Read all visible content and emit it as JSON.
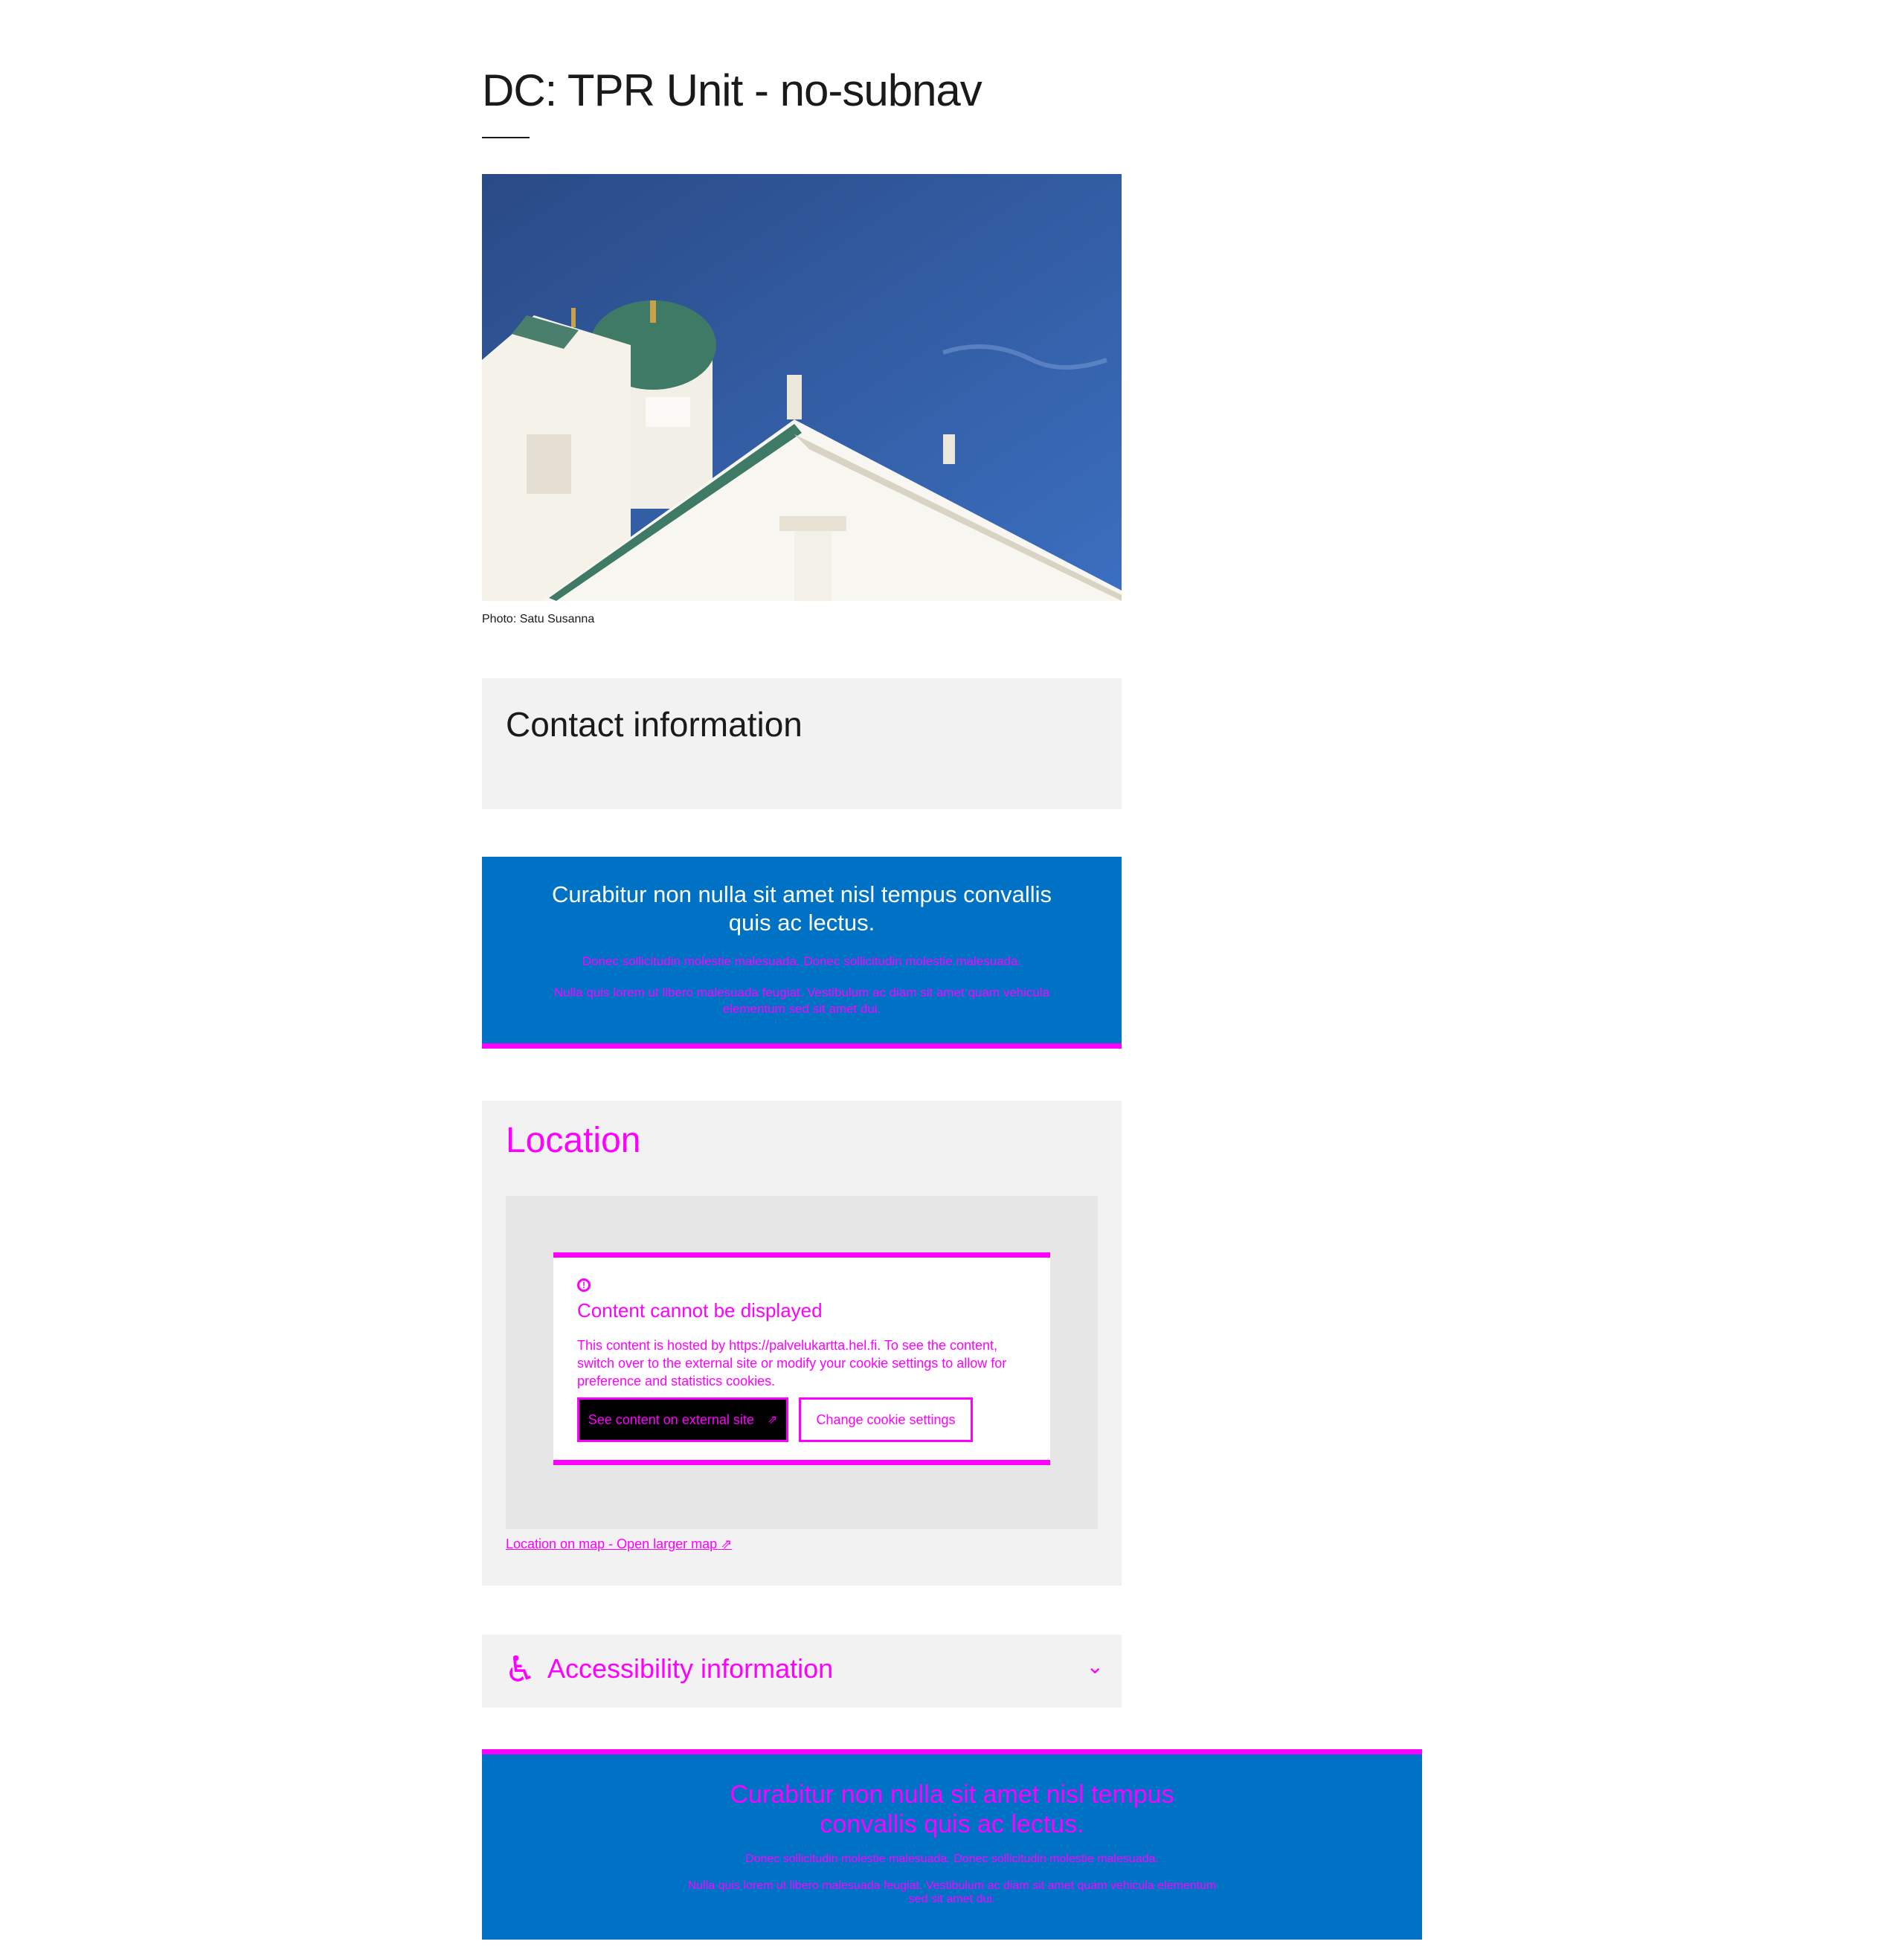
{
  "page": {
    "title": "DC: TPR Unit - no-subnav"
  },
  "hero": {
    "caption": "Photo: Satu Susanna"
  },
  "contact": {
    "heading": "Contact information"
  },
  "banner_top": {
    "title": "Curabitur non nulla sit amet nisl tempus convallis quis ac lectus.",
    "text1": "Donec sollicitudin molestie malesuada. Donec sollicitudin molestie malesuada.",
    "text2": "Nulla quis lorem ut libero malesuada feugiat. Vestibulum ac diam sit amet quam vehicula elementum sed sit amet dui."
  },
  "location": {
    "heading": "Location",
    "notice_title": "Content cannot be displayed",
    "notice_body": "This content is hosted by https://palvelukartta.hel.fi. To see the content, switch over to the external site or modify your cookie settings to allow for preference and statistics cookies.",
    "external_button": "See content on external site",
    "cookie_button": "Change cookie settings",
    "map_link": "Location on map - Open larger map"
  },
  "accessibility": {
    "label": "Accessibility information"
  },
  "banner_bottom": {
    "title": "Curabitur non nulla sit amet nisl tempus convallis quis ac lectus.",
    "text1": "Donec sollicitudin molestie malesuada. Donec sollicitudin molestie malesuada.",
    "text2": "Nulla quis lorem ut libero malesuada feugiat. Vestibulum ac diam sit amet quam vehicula elementum sed sit amet dui."
  },
  "colors": {
    "banner_blue": "#0072c6",
    "highlight_magenta": "#ff00ff",
    "panel_gray": "#f2f2f2"
  }
}
